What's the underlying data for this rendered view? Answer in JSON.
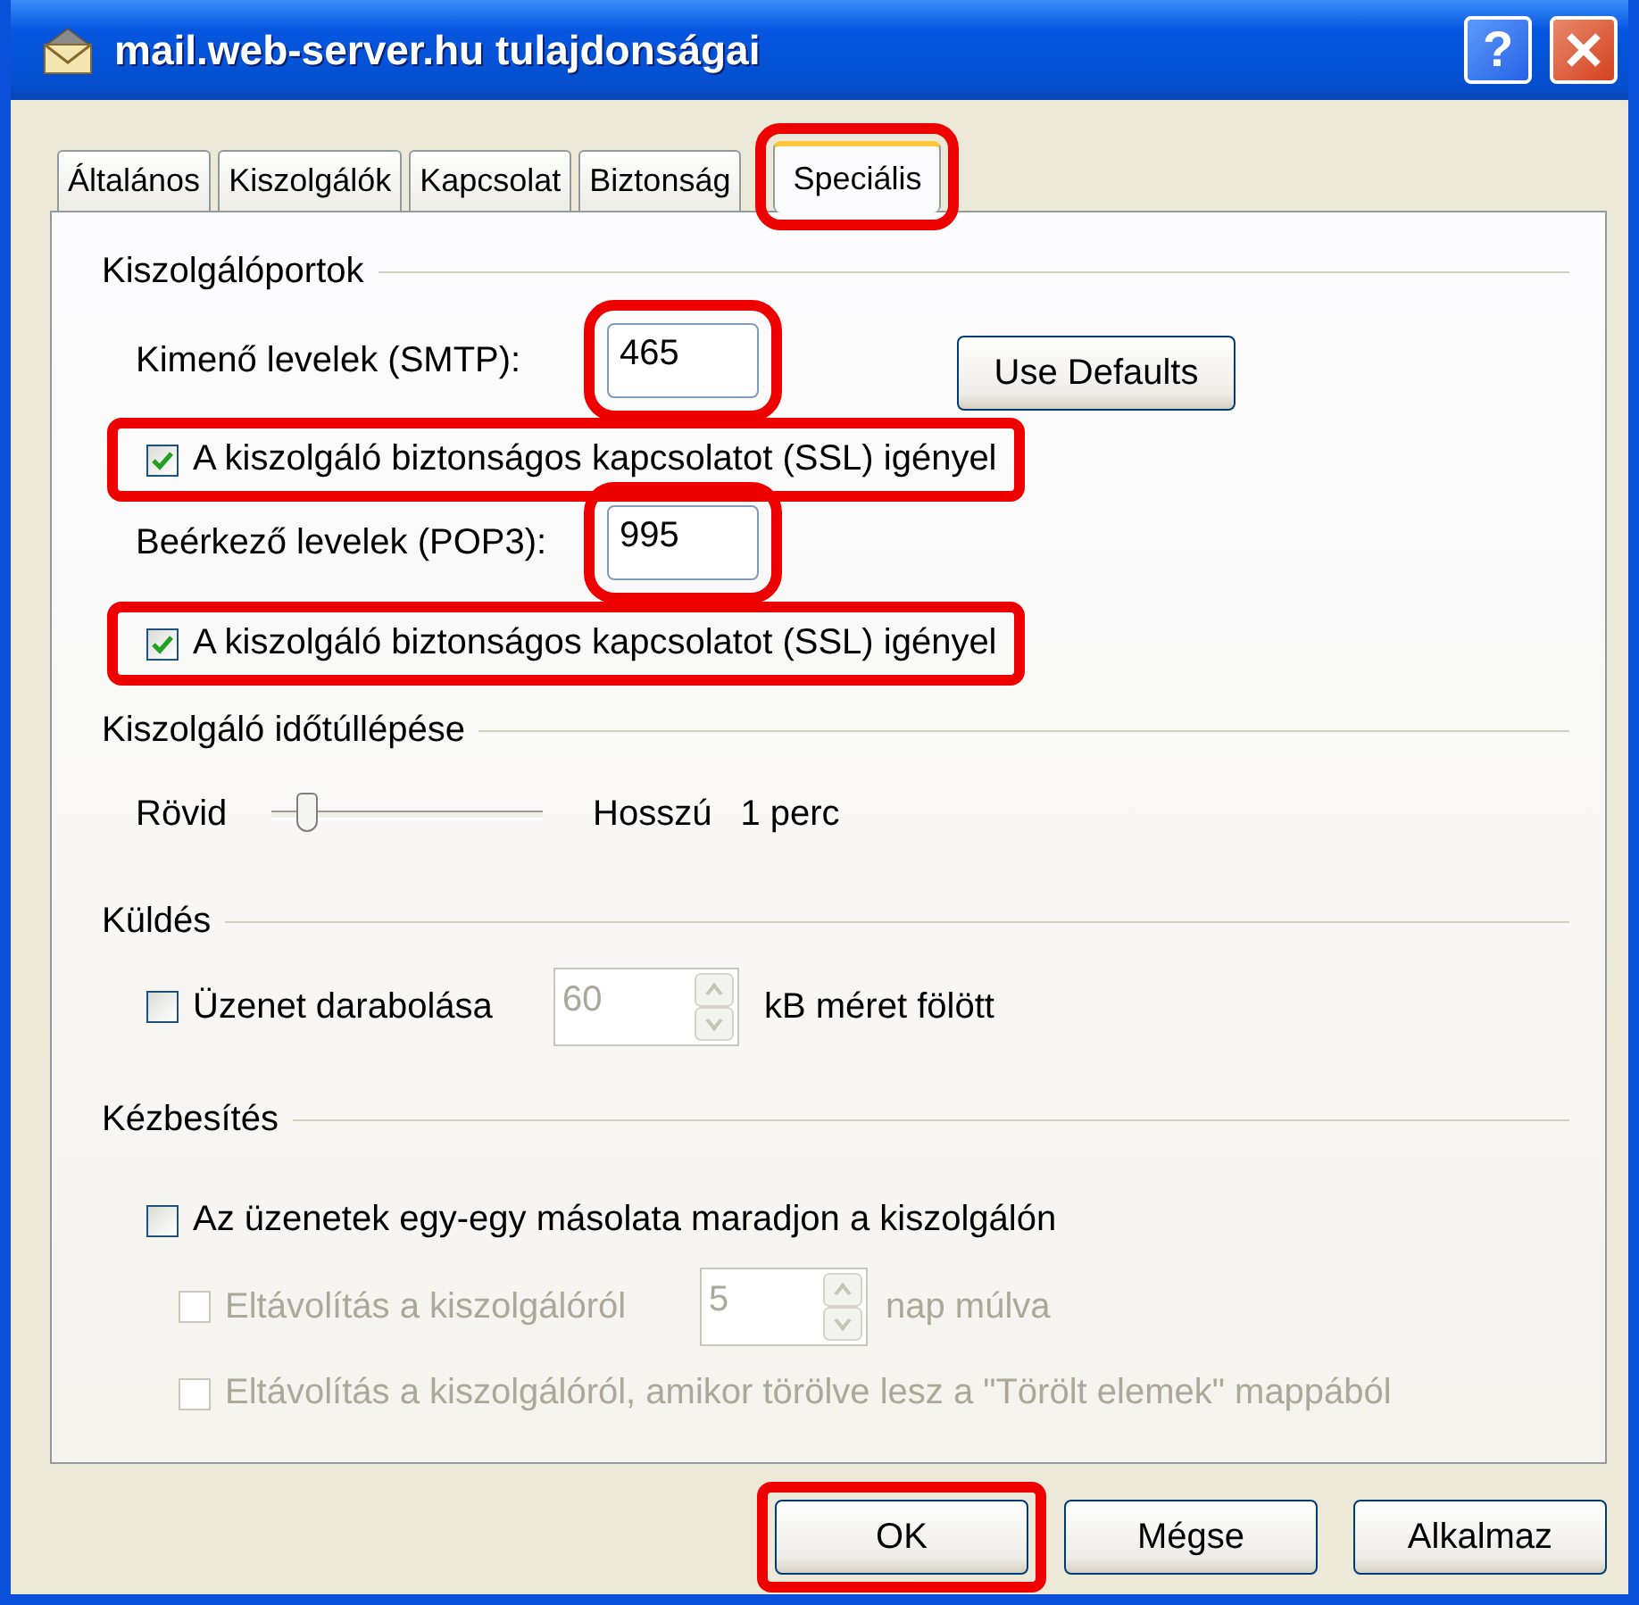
{
  "window": {
    "title": "mail.web-server.hu tulajdonságai",
    "help": "?"
  },
  "tabs": [
    {
      "label": "Általános",
      "selected": false,
      "highlighted": false
    },
    {
      "label": "Kiszolgálók",
      "selected": false,
      "highlighted": false
    },
    {
      "label": "Kapcsolat",
      "selected": false,
      "highlighted": false
    },
    {
      "label": "Biztonság",
      "selected": false,
      "highlighted": false
    },
    {
      "label": "Speciális",
      "selected": true,
      "highlighted": true
    }
  ],
  "server_ports": {
    "title": "Kiszolgálóportok",
    "outgoing": {
      "label": "Kimenő levelek (SMTP):",
      "value": "465",
      "highlighted": true
    },
    "defaults_button": "Use Defaults",
    "outgoing_ssl": {
      "label": "A kiszolgáló biztonságos kapcsolatot (SSL) igényel",
      "checked": true,
      "disabled": false,
      "highlighted": true
    },
    "incoming": {
      "label": "Beérkező levelek (POP3):",
      "value": "995",
      "highlighted": true
    },
    "incoming_ssl": {
      "label": "A kiszolgáló biztonságos kapcsolatot (SSL) igényel",
      "checked": true,
      "disabled": false,
      "highlighted": true
    }
  },
  "timeout": {
    "title": "Kiszolgáló időtúllépése",
    "min_label": "Rövid",
    "level": 0.1,
    "max_label": "Hosszú",
    "reading": "1 perc"
  },
  "sending": {
    "title": "Küldés",
    "split": {
      "label": "Üzenet darabolása",
      "checked": false,
      "disabled": false,
      "highlighted": false
    },
    "size": {
      "value": "60",
      "disabled": true
    },
    "unit": "kB méret fölött"
  },
  "delivery": {
    "title": "Kézbesítés",
    "keep_copy": {
      "label": "Az üzenetek egy-egy másolata maradjon a kiszolgálón",
      "checked": false,
      "disabled": false,
      "highlighted": false
    },
    "remove_after": {
      "label": "Eltávolítás a kiszolgálóról",
      "checked": false,
      "disabled": true,
      "highlighted": false
    },
    "days": {
      "value": "5",
      "disabled": true
    },
    "days_unit": "nap múlva",
    "remove_deleted": {
      "label": "Eltávolítás a kiszolgálóról, amikor törölve lesz a \"Törölt elemek\" mappából",
      "checked": false,
      "disabled": true,
      "highlighted": false
    }
  },
  "buttons": [
    {
      "label": "OK",
      "highlighted": true
    },
    {
      "label": "Mégse",
      "highlighted": false
    },
    {
      "label": "Alkalmaz",
      "highlighted": false
    }
  ]
}
